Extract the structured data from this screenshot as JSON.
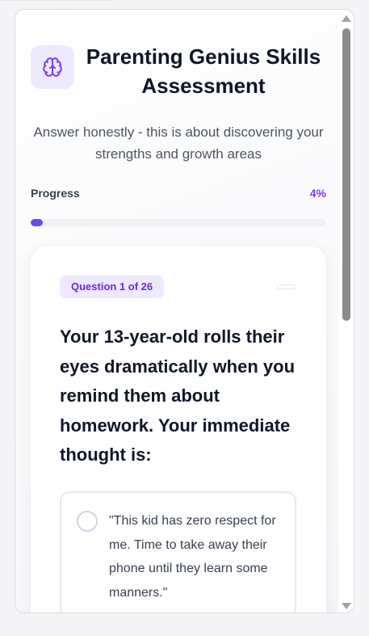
{
  "header": {
    "icon": "brain-icon",
    "title": "Parenting Genius Skills Assessment",
    "subtitle": "Answer honestly - this is about discovering your strengths and growth areas"
  },
  "progress": {
    "label": "Progress",
    "value_text": "4%",
    "fraction": 0.04
  },
  "question": {
    "badge": "Question 1 of 26",
    "text": "Your 13-year-old rolls their eyes dramatically when you remind them about homework. Your immediate thought is:"
  },
  "options": [
    {
      "text": "\"This kid has zero respect for me. Time to take away their phone until they learn some manners.\""
    }
  ],
  "colors": {
    "accent": "#7c3aed",
    "progress_fill": "#6d4ae6",
    "badge_bg": "#ede9fe"
  }
}
